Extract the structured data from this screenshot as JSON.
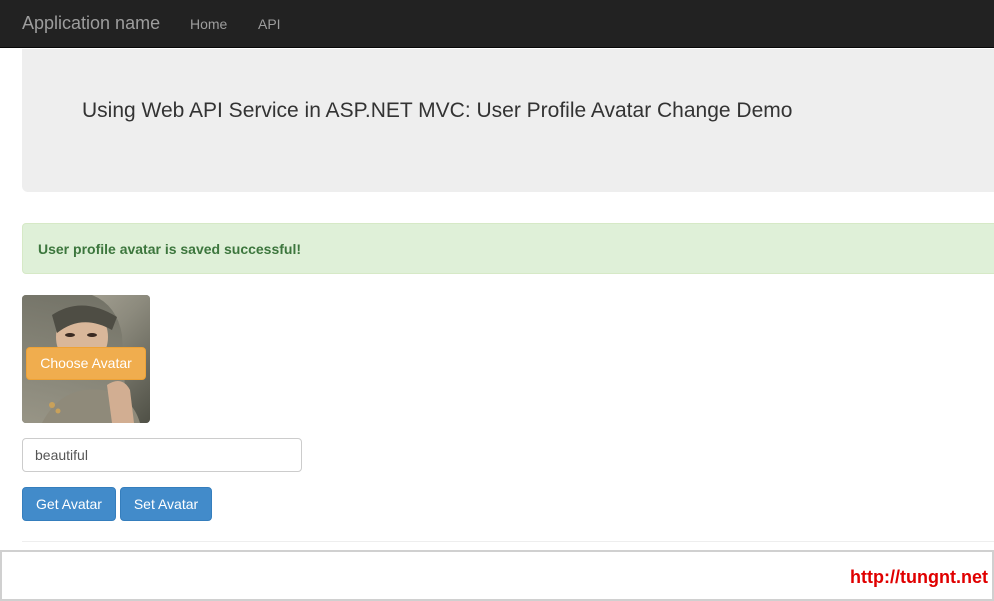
{
  "navbar": {
    "brand": "Application name",
    "links": [
      {
        "label": "Home"
      },
      {
        "label": "API"
      }
    ]
  },
  "jumbotron": {
    "title": "Using Web API Service in ASP.NET MVC: User Profile Avatar Change Demo"
  },
  "alert": {
    "message": "User profile avatar is saved successful!",
    "color": "#3c763d",
    "background": "#dff0d8"
  },
  "avatar": {
    "choose_label": "Choose Avatar"
  },
  "avatar_input": {
    "value": "beautiful"
  },
  "actions": {
    "get_label": "Get Avatar",
    "set_label": "Set Avatar",
    "color": "#428bca"
  },
  "watermark": {
    "text": "http://tungnt.net",
    "color": "#e00000"
  }
}
